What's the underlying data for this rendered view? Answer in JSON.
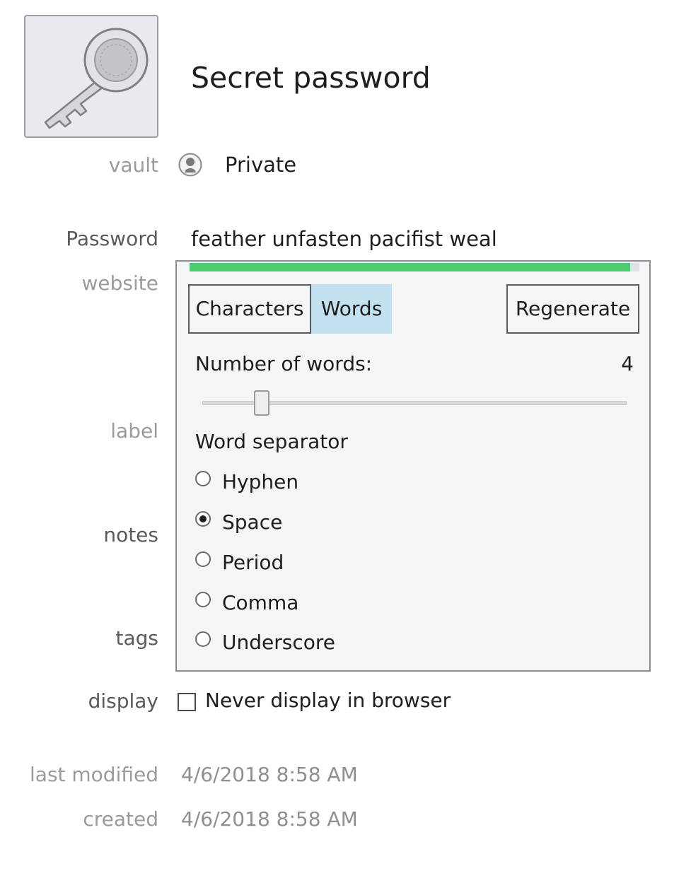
{
  "item": {
    "title": "Secret password",
    "icon": "key-icon"
  },
  "labels": {
    "vault": "vault",
    "password": "Password",
    "website": "website",
    "label": "label",
    "notes": "notes",
    "tags": "tags",
    "display": "display",
    "last_modified": "last modified",
    "created": "created"
  },
  "vault": {
    "icon": "person-icon",
    "value": "Private"
  },
  "password": {
    "value": "feather unfasten pacifist weal",
    "strength_fraction": 0.98,
    "strength_color": "#4ecb71"
  },
  "generator": {
    "tabs": [
      {
        "label": "Characters",
        "selected": false
      },
      {
        "label": "Words",
        "selected": true
      }
    ],
    "regenerate_label": "Regenerate",
    "number_of_words_label": "Number of words:",
    "number_of_words_value": "4",
    "slider_fraction": 0.14,
    "separator_label": "Word separator",
    "separators": [
      {
        "label": "Hyphen",
        "checked": false
      },
      {
        "label": "Space",
        "checked": true
      },
      {
        "label": "Period",
        "checked": false
      },
      {
        "label": "Comma",
        "checked": false
      },
      {
        "label": "Underscore",
        "checked": false
      }
    ],
    "accent_color": "#c4e1f0"
  },
  "display": {
    "checkbox_label": "Never display in browser",
    "checked": false
  },
  "dates": {
    "last_modified": "4/6/2018 8:58 AM",
    "created": "4/6/2018 8:58 AM"
  }
}
